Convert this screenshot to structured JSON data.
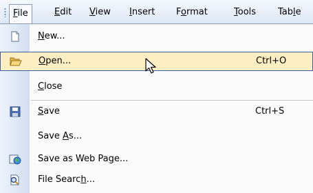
{
  "menubar": {
    "items": [
      {
        "pre": "",
        "u": "F",
        "post": "ile"
      },
      {
        "pre": "",
        "u": "E",
        "post": "dit"
      },
      {
        "pre": "",
        "u": "V",
        "post": "iew"
      },
      {
        "pre": "",
        "u": "I",
        "post": "nsert"
      },
      {
        "pre": "F",
        "u": "o",
        "post": "rmat"
      },
      {
        "pre": "",
        "u": "T",
        "post": "ools"
      },
      {
        "pre": "Tab",
        "u": "l",
        "post": "e"
      }
    ]
  },
  "file_menu": {
    "items": [
      {
        "pre": "",
        "u": "N",
        "post": "ew...",
        "shortcut": "",
        "icon": "new-document-icon"
      },
      {
        "pre": "",
        "u": "O",
        "post": "pen...",
        "shortcut": "Ctrl+O",
        "icon": "open-folder-icon",
        "highlighted": true
      },
      {
        "pre": "",
        "u": "C",
        "post": "lose",
        "shortcut": "",
        "icon": ""
      },
      {
        "pre": "",
        "u": "S",
        "post": "ave",
        "shortcut": "Ctrl+S",
        "icon": "save-disk-icon"
      },
      {
        "pre": "Save ",
        "u": "A",
        "post": "s...",
        "shortcut": "",
        "icon": ""
      },
      {
        "pre": "Save as Web Pa",
        "u": "g",
        "post": "e...",
        "shortcut": "",
        "icon": "web-page-icon"
      },
      {
        "pre": "File Searc",
        "u": "h",
        "post": "...",
        "shortcut": "",
        "icon": "file-search-icon"
      }
    ]
  },
  "colors": {
    "menubar_top": "#f4f8fd",
    "menubar_bottom": "#dde7f5",
    "highlight_fill": "#ffeec2",
    "highlight_border": "#3c5fa3"
  }
}
